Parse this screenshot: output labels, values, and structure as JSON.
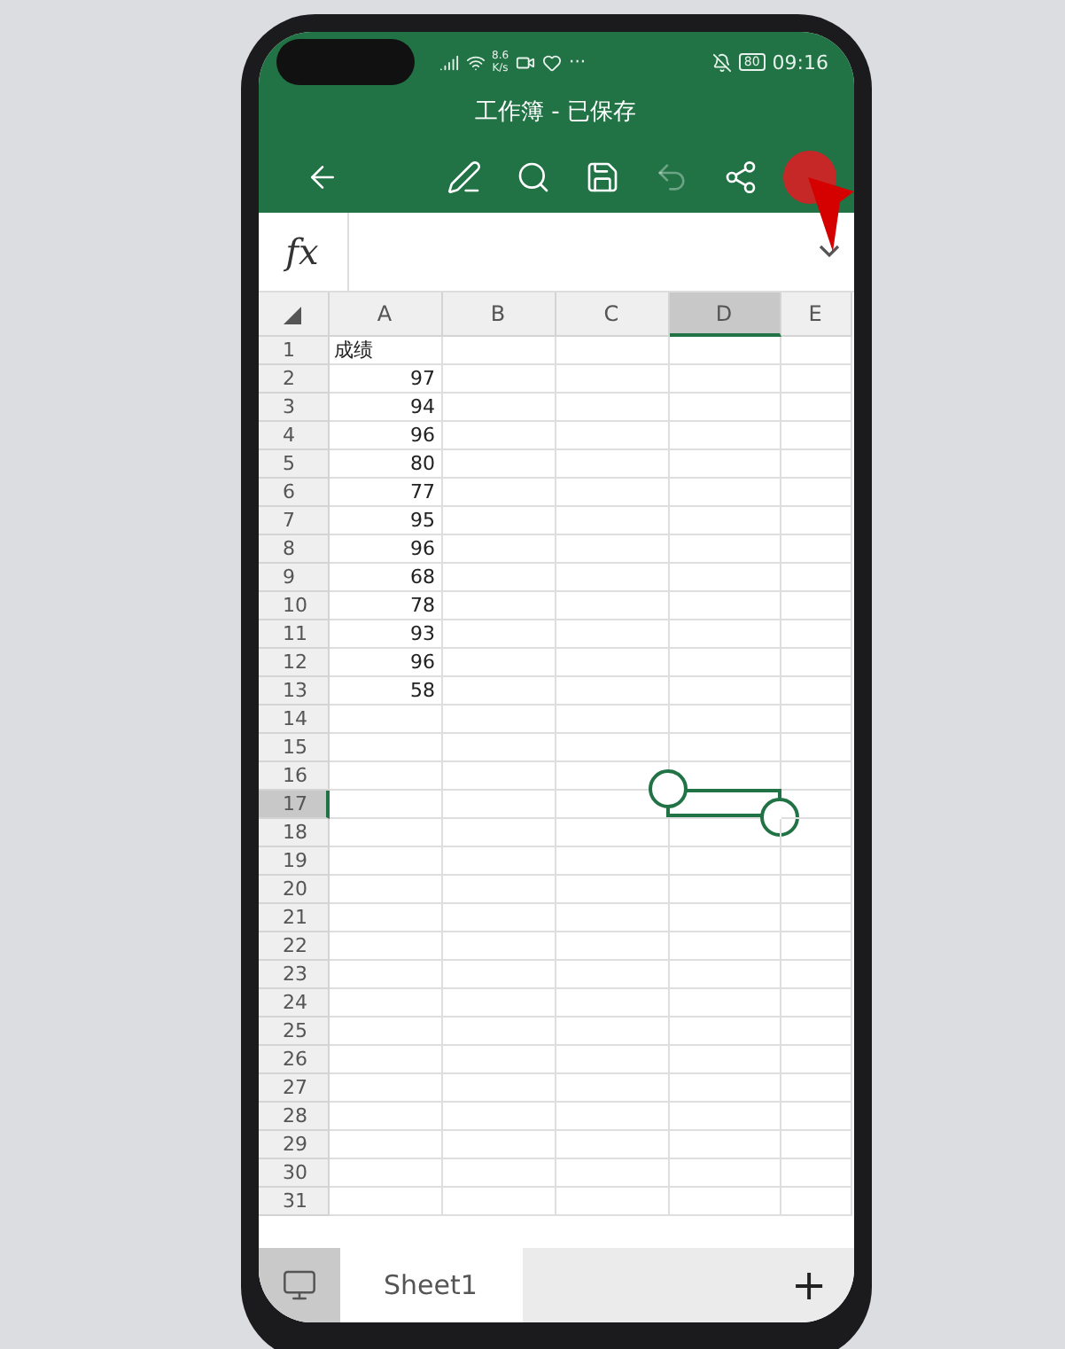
{
  "status_bar": {
    "network_speed": "8.6",
    "speed_unit": "K/s",
    "more": "···",
    "battery": "80",
    "time": "09:16"
  },
  "title": "工作簿 - 已保存",
  "toolbar": [
    {
      "kind": "back",
      "disabled": false
    },
    {
      "kind": "pen",
      "disabled": false
    },
    {
      "kind": "search",
      "disabled": false
    },
    {
      "kind": "save",
      "disabled": false
    },
    {
      "kind": "undo",
      "disabled": true
    },
    {
      "kind": "share",
      "disabled": false
    },
    {
      "kind": "more",
      "disabled": false
    }
  ],
  "formula_bar": {
    "label": "fx"
  },
  "columns": [
    {
      "label": "A",
      "selected": false
    },
    {
      "label": "B",
      "selected": false
    },
    {
      "label": "C",
      "selected": false
    },
    {
      "label": "D",
      "selected": true
    },
    {
      "label": "E",
      "selected": false
    }
  ],
  "rows": [
    {
      "label": "1",
      "selected": false,
      "cells": [
        {
          "text": "成绩",
          "kind": "text"
        }
      ]
    },
    {
      "label": "2",
      "selected": false,
      "cells": [
        {
          "text": "97",
          "kind": "number"
        }
      ]
    },
    {
      "label": "3",
      "selected": false,
      "cells": [
        {
          "text": "94",
          "kind": "number"
        }
      ]
    },
    {
      "label": "4",
      "selected": false,
      "cells": [
        {
          "text": "96",
          "kind": "number"
        }
      ]
    },
    {
      "label": "5",
      "selected": false,
      "cells": [
        {
          "text": "80",
          "kind": "number"
        }
      ]
    },
    {
      "label": "6",
      "selected": false,
      "cells": [
        {
          "text": "77",
          "kind": "number"
        }
      ]
    },
    {
      "label": "7",
      "selected": false,
      "cells": [
        {
          "text": "95",
          "kind": "number"
        }
      ]
    },
    {
      "label": "8",
      "selected": false,
      "cells": [
        {
          "text": "96",
          "kind": "number"
        }
      ]
    },
    {
      "label": "9",
      "selected": false,
      "cells": [
        {
          "text": "68",
          "kind": "number"
        }
      ]
    },
    {
      "label": "10",
      "selected": false,
      "cells": [
        {
          "text": "78",
          "kind": "number"
        }
      ]
    },
    {
      "label": "11",
      "selected": false,
      "cells": [
        {
          "text": "93",
          "kind": "number"
        }
      ]
    },
    {
      "label": "12",
      "selected": false,
      "cells": [
        {
          "text": "96",
          "kind": "number"
        }
      ]
    },
    {
      "label": "13",
      "selected": false,
      "cells": [
        {
          "text": "58",
          "kind": "number"
        }
      ]
    },
    {
      "label": "14",
      "selected": false,
      "cells": []
    },
    {
      "label": "15",
      "selected": false,
      "cells": []
    },
    {
      "label": "16",
      "selected": false,
      "cells": []
    },
    {
      "label": "17",
      "selected": true,
      "cells": []
    },
    {
      "label": "18",
      "selected": false,
      "cells": []
    },
    {
      "label": "19",
      "selected": false,
      "cells": []
    },
    {
      "label": "20",
      "selected": false,
      "cells": []
    },
    {
      "label": "21",
      "selected": false,
      "cells": []
    },
    {
      "label": "22",
      "selected": false,
      "cells": []
    },
    {
      "label": "23",
      "selected": false,
      "cells": []
    },
    {
      "label": "24",
      "selected": false,
      "cells": []
    },
    {
      "label": "25",
      "selected": false,
      "cells": []
    },
    {
      "label": "26",
      "selected": false,
      "cells": []
    },
    {
      "label": "27",
      "selected": false,
      "cells": []
    },
    {
      "label": "28",
      "selected": false,
      "cells": []
    },
    {
      "label": "29",
      "selected": false,
      "cells": []
    },
    {
      "label": "30",
      "selected": false,
      "cells": []
    },
    {
      "label": "31",
      "selected": false,
      "cells": []
    }
  ],
  "sheet_tabs": [
    {
      "label": "Sheet1",
      "selected": true
    }
  ],
  "add_sheet": "+"
}
